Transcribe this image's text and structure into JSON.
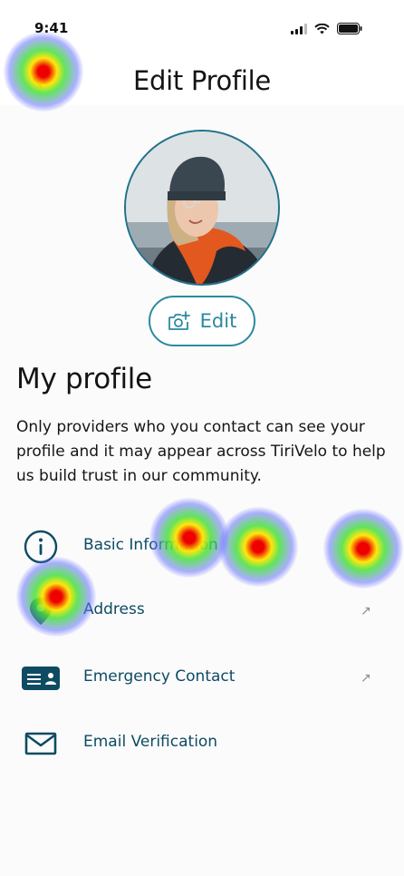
{
  "status": {
    "time": "9:41",
    "icons": [
      "signal-icon",
      "wifi-icon",
      "battery-icon"
    ]
  },
  "header": {
    "back_icon": "back-arrow-icon",
    "title": "Edit Profile"
  },
  "avatar": {
    "ring_color": "#22718a"
  },
  "edit_button": {
    "label": "Edit",
    "icon": "camera-plus-icon"
  },
  "profile": {
    "title": "My profile",
    "description": "Only providers who you contact can see your profile and it may appear across TiriVelo to help us build trust in our community."
  },
  "menu": {
    "items": [
      {
        "label": "Basic Information",
        "icon": "info-icon",
        "has_arrow": false
      },
      {
        "label": "Address",
        "icon": "location-pin-icon",
        "has_arrow": true
      },
      {
        "label": "Emergency Contact",
        "icon": "id-card-icon",
        "has_arrow": true
      },
      {
        "label": "Email Verification",
        "icon": "mail-icon",
        "has_arrow": false
      }
    ],
    "arrow_glyph": "↗"
  },
  "colors": {
    "accent": "#2a8aa0",
    "menu_text": "#0e4b63",
    "background": "#fbfbfb"
  }
}
